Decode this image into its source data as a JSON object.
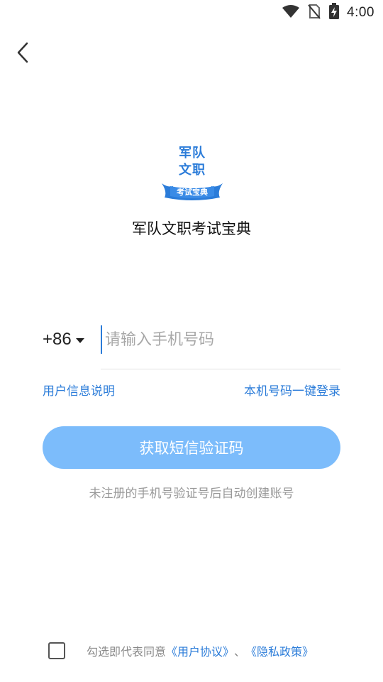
{
  "status_bar": {
    "time": "4:00",
    "icons": [
      "wifi-icon",
      "no-sim-icon",
      "battery-charging-icon"
    ]
  },
  "nav": {
    "back_icon": "chevron-left-icon"
  },
  "logo": {
    "line1": "军队",
    "line2": "文职",
    "banner": "考试宝典",
    "color": "#2b7cd9"
  },
  "app_name": "军队文职考试宝典",
  "login": {
    "country_code": "+86",
    "phone_placeholder": "请输入手机号码",
    "phone_value": "",
    "user_info_link": "用户信息说明",
    "one_click_login_link": "本机号码一键登录",
    "sms_button_label": "获取短信验证码",
    "hint": "未注册的手机号验证号后自动创建账号"
  },
  "agreement": {
    "checked": false,
    "prefix": "勾选即代表同意",
    "user_agreement": "《用户协议》",
    "separator": "、",
    "privacy_policy": "《隐私政策》"
  },
  "colors": {
    "accent": "#2b7cd9",
    "button_bg": "#7cbcfb",
    "hint_text": "#999999"
  }
}
